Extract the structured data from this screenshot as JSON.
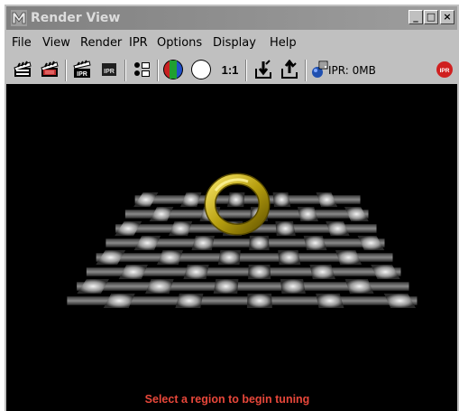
{
  "window": {
    "title": "Render View",
    "minimize": "_",
    "maximize": "□",
    "close": "×"
  },
  "menubar": {
    "items": [
      "File",
      "View",
      "Render",
      "IPR",
      "Options",
      "Display",
      "Help"
    ]
  },
  "toolbar": {
    "zoom_label": "1:1",
    "ipr_memory": "IPR: 0MB",
    "icons": [
      "render-clapper-icon",
      "redo-render-icon",
      "ipr-render-icon",
      "ipr-refresh-icon",
      "render-region-icon",
      "rgb-channel-icon",
      "alpha-channel-icon",
      "one-to-one-icon",
      "keep-image-icon",
      "remove-image-icon",
      "ipr-memory-icon",
      "stop-ipr-icon"
    ]
  },
  "render": {
    "status_message": "Select a region to begin tuning"
  },
  "colors": {
    "status_text": "#e8473a",
    "torus": "#d8c420",
    "background": "#000000"
  }
}
